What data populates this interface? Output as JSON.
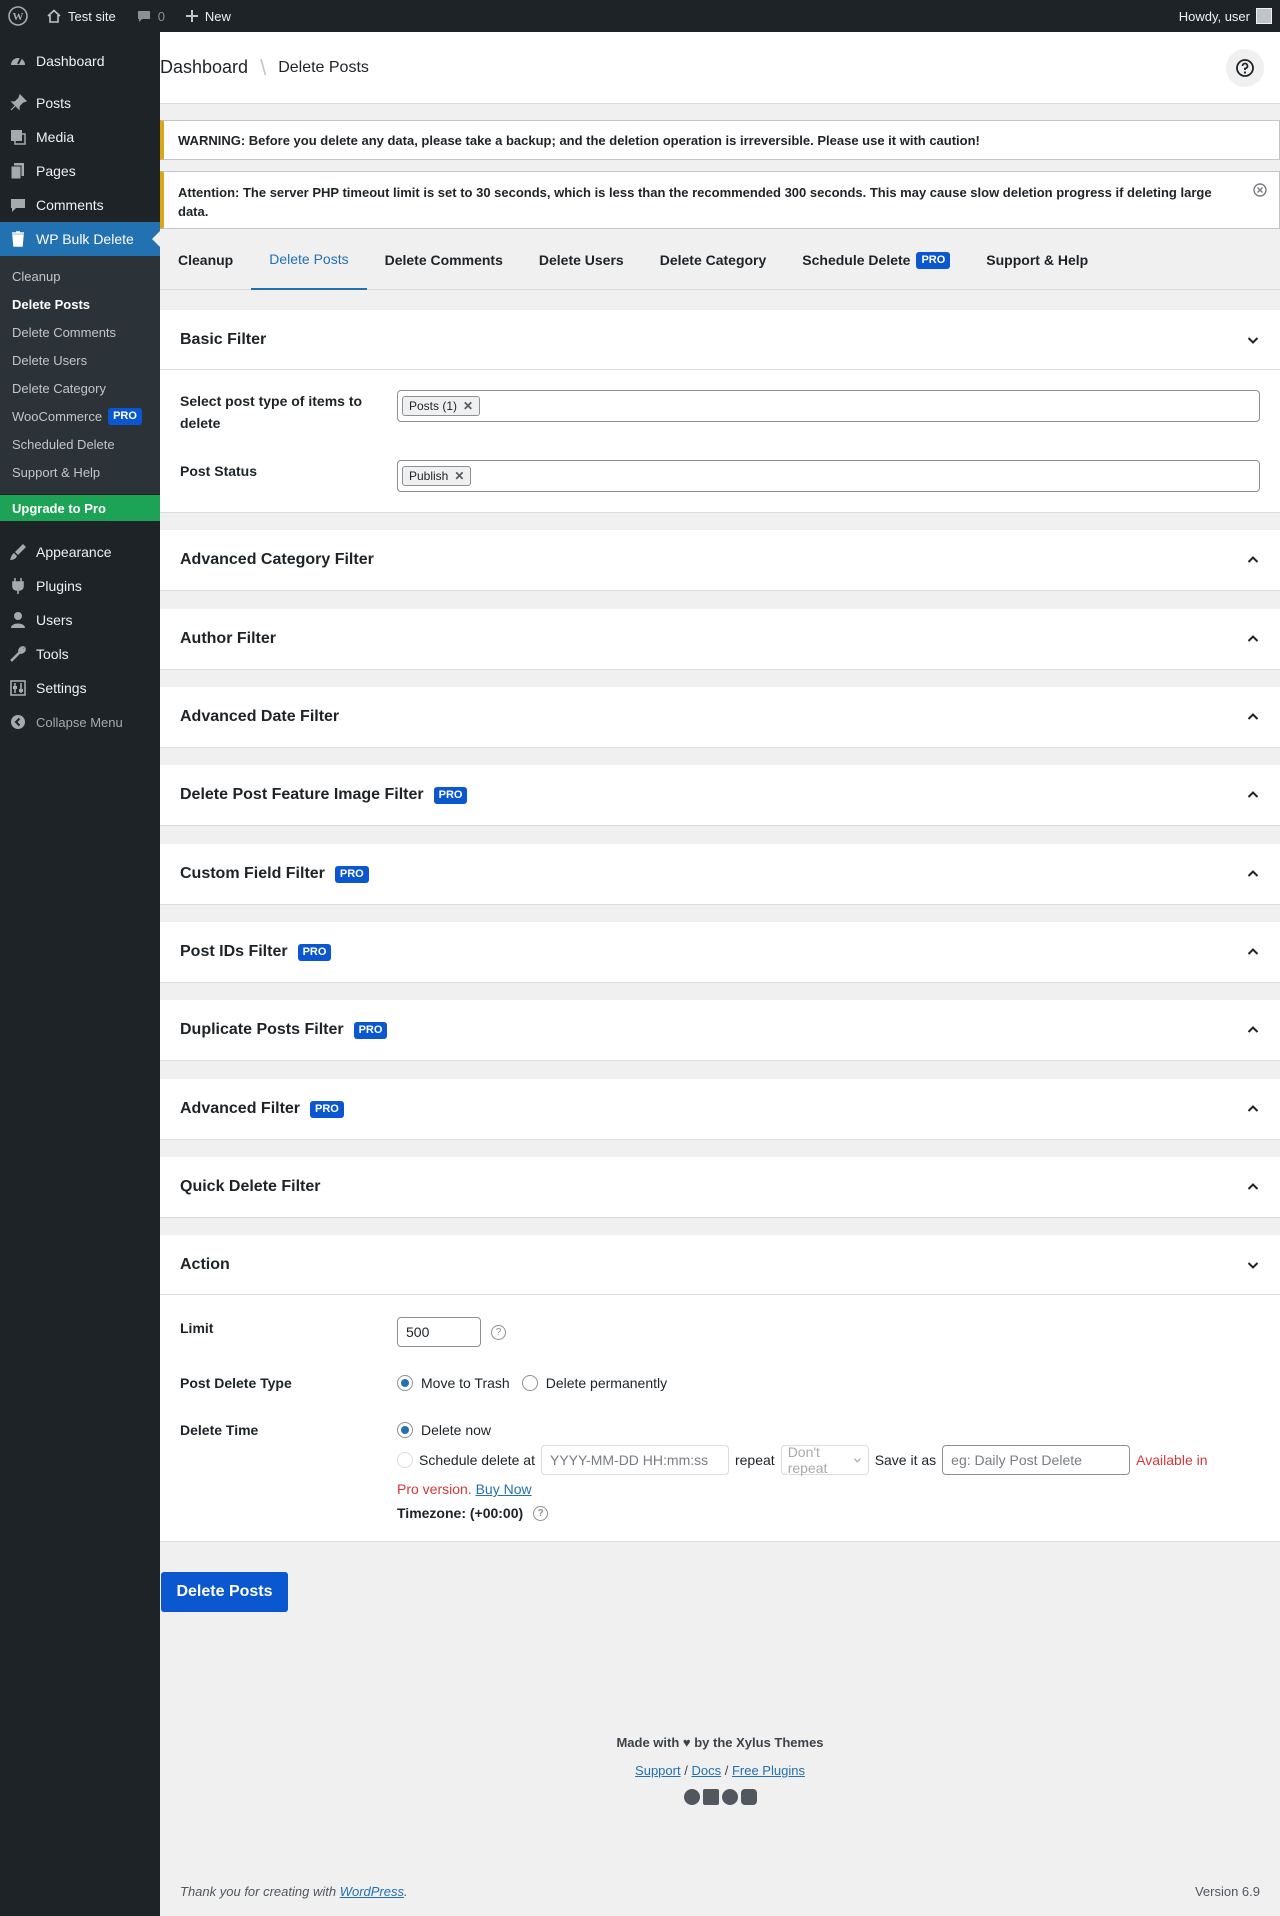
{
  "adminbar": {
    "site_name": "Test site",
    "comments_count": "0",
    "new_label": "New",
    "greeting": "Howdy, user"
  },
  "sidebar": {
    "dashboard": "Dashboard",
    "posts": "Posts",
    "media": "Media",
    "pages": "Pages",
    "comments": "Comments",
    "active_plugin": "WP Bulk Delete",
    "submenu": {
      "cleanup": "Cleanup",
      "delete_posts": "Delete Posts",
      "delete_comments": "Delete Comments",
      "delete_users": "Delete Users",
      "delete_category": "Delete Category",
      "woocommerce": "WooCommerce",
      "woocommerce_badge": "PRO",
      "scheduled_delete": "Scheduled Delete",
      "support_help": "Support & Help"
    },
    "upgrade": "Upgrade to Pro",
    "appearance": "Appearance",
    "plugins": "Plugins",
    "users": "Users",
    "tools": "Tools",
    "settings": "Settings",
    "collapse": "Collapse Menu"
  },
  "header": {
    "breadcrumb_root": "Dashboard",
    "breadcrumb_current": "Delete Posts"
  },
  "notices": {
    "warning": "WARNING: Before you delete any data, please take a backup; and the deletion operation is irreversible. Please use it with caution!",
    "attention": "Attention: The server PHP timeout limit is set to 30 seconds, which is less than the recommended 300 seconds. This may cause slow deletion progress if deleting large data."
  },
  "tabs": {
    "cleanup": "Cleanup",
    "delete_posts": "Delete Posts",
    "delete_comments": "Delete Comments",
    "delete_users": "Delete Users",
    "delete_category": "Delete Category",
    "schedule_delete": "Schedule Delete",
    "schedule_badge": "PRO",
    "support": "Support & Help"
  },
  "basic_filter": {
    "title": "Basic Filter",
    "post_type_label": "Select post type of items to delete",
    "post_type_tag": "Posts (1)",
    "post_status_label": "Post Status",
    "post_status_tag": "Publish",
    "remove_symbol": "✕"
  },
  "pro_badge": "PRO",
  "filters": {
    "advanced_category": "Advanced Category Filter",
    "author": "Author Filter",
    "advanced_date": "Advanced Date Filter",
    "feature_image": "Delete Post Feature Image Filter",
    "custom_field": "Custom Field Filter",
    "post_ids": "Post IDs Filter",
    "duplicate_posts": "Duplicate Posts Filter",
    "advanced": "Advanced Filter",
    "quick_delete": "Quick Delete Filter"
  },
  "action": {
    "title": "Action",
    "limit_label": "Limit",
    "limit_value": "500",
    "delete_type_label": "Post Delete Type",
    "move_to_trash": "Move to Trash",
    "delete_permanently": "Delete permanently",
    "delete_time_label": "Delete Time",
    "delete_now": "Delete now",
    "schedule_at": "Schedule delete at",
    "datetime_placeholder": "YYYY-MM-DD HH:mm:ss",
    "repeat_label": "repeat",
    "repeat_value": "Don't repeat",
    "save_as_label": "Save it as",
    "save_as_placeholder": "eg: Daily Post Delete",
    "available_in": "Available in",
    "pro_version": "Pro version.",
    "buy_now": "Buy Now",
    "timezone": "Timezone: (+00:00)"
  },
  "delete_button": "Delete Posts",
  "footer": {
    "made_with": "Made with ♥ by the Xylus Themes",
    "support": "Support",
    "docs": "Docs",
    "free_plugins": "Free Plugins",
    "sep": "/",
    "thank_you": "Thank you for creating with",
    "wordpress": "WordPress",
    "version": "Version 6.9"
  }
}
